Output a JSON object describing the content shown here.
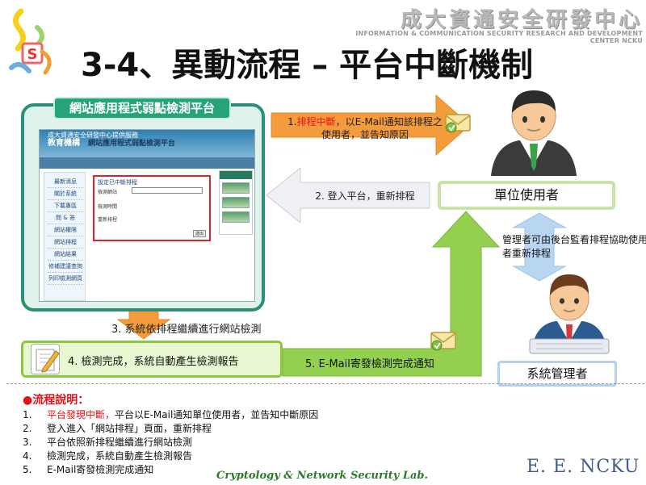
{
  "header": {
    "org_cn": "成大資通安全研發中心",
    "org_en": "INFORMATION & COMMUNICATION SECURITY RESEARCH AND DEVELOPMENT CENTER NCKU",
    "title": "3-4、異動流程 – 平台中斷機制"
  },
  "platform": {
    "tab_label": "網站應用程式弱點檢測平台",
    "screenshot": {
      "banner_left": "教育機構",
      "banner_right": "網站應用程式弱點檢測平台",
      "subbar": "成大資通安全研發中心提供服務",
      "sidebar_items": [
        "最新消息",
        "關於系統",
        "下載專區",
        "問 & 答",
        "網站權限",
        "網站排程",
        "網站結果",
        "修補建議查詢",
        "列印檢測網頁"
      ],
      "form_title": "設定已中斷排程",
      "form_rows": [
        "檢測網站",
        "檢測時間",
        "重新排程"
      ],
      "form_button": "送出"
    }
  },
  "steps": {
    "step1_highlight": "排程中斷",
    "step1_rest": "，以E-Mail通知該排程之使用者，並告知原因",
    "step1_prefix": "1.",
    "step2": "2. 登入平台，重新排程",
    "step3": "3. 系統依排程繼續進行網站檢測",
    "step4": "4. 檢測完成，系統自動產生檢測報告",
    "step5": "5. E-Mail寄發檢測完成通知"
  },
  "actors": {
    "unit_user": "單位使用者",
    "admin": "系統管理者",
    "monitor_note": "管理者可由後台監看排程協助使用者重新排程"
  },
  "notes": {
    "heading": "●流程說明：",
    "items": [
      {
        "num": "1.",
        "highlight": "平台發現中斷，",
        "text": "平台以E-Mail通知單位使用者，並告知中斷原因"
      },
      {
        "num": "2.",
        "highlight": "",
        "text": "登入進入「網站排程」頁面，重新排程"
      },
      {
        "num": "3.",
        "highlight": "",
        "text": "平台依照新排程繼續進行網站檢測"
      },
      {
        "num": "4.",
        "highlight": "",
        "text": "檢測完成，系統自動產生檢測報告"
      },
      {
        "num": "5.",
        "highlight": "",
        "text": "E-Mail寄發檢測完成通知"
      }
    ]
  },
  "footer": {
    "lab": "Cryptology & Network Security Lab.",
    "dept": "E. E. NCKU"
  },
  "colors": {
    "orange_arrow": "#f49c3c",
    "green_arrow": "#93d050",
    "panel_border": "#2c9078",
    "highlight_red": "#e2141b"
  }
}
